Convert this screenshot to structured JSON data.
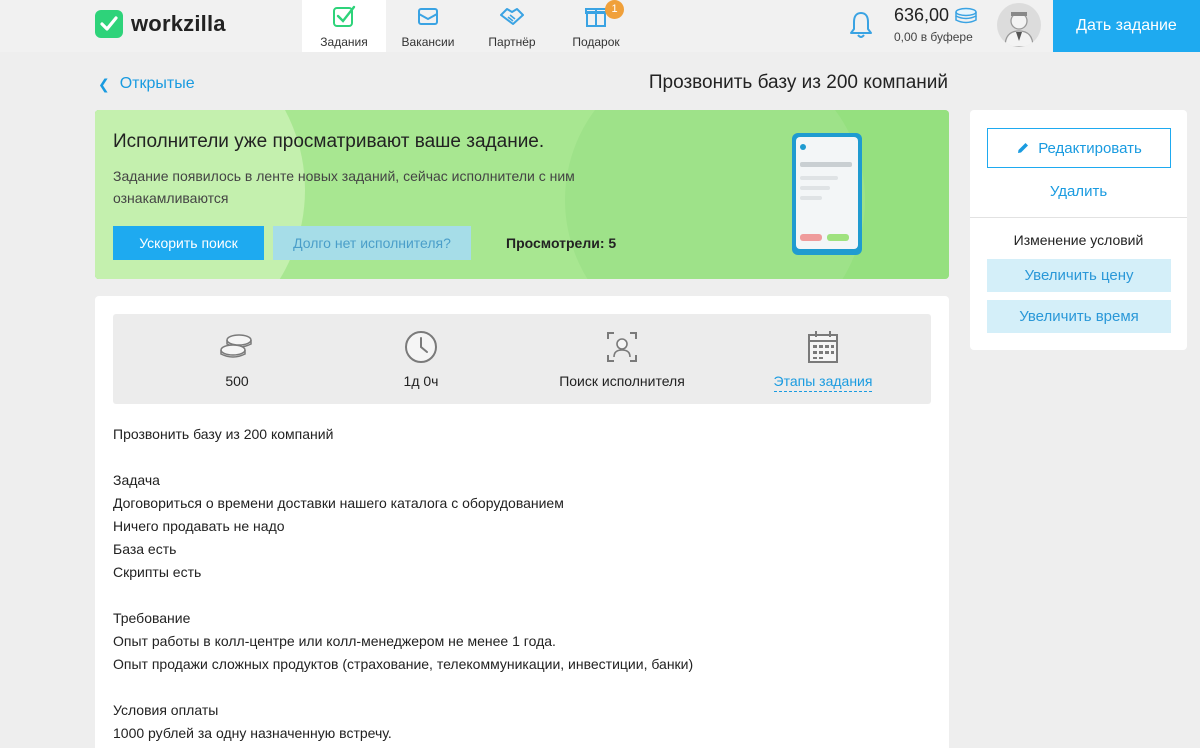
{
  "header": {
    "logo_text": "workzilla",
    "nav": [
      {
        "label": "Задания",
        "icon": "tasks-check-icon",
        "active": true
      },
      {
        "label": "Вакансии",
        "icon": "vacancies-mail-icon",
        "active": false
      },
      {
        "label": "Партнёр",
        "icon": "partner-handshake-icon",
        "active": false
      },
      {
        "label": "Подарок",
        "icon": "gift-icon",
        "active": false,
        "badge": "1"
      }
    ],
    "balance": "636,00",
    "buffer": "0,00 в буфере",
    "give_task": "Дать задание"
  },
  "back_label": "Открытые",
  "page_title": "Прозвонить базу из 200 компаний",
  "banner": {
    "title": "Исполнители уже просматривают ваше задание.",
    "text": "Задание появилось в ленте новых заданий, сейчас исполнители с ним ознакамливаются",
    "speed_button": "Ускорить поиск",
    "long_button": "Долго нет исполнителя?",
    "viewed": "Просмотрели: 5"
  },
  "side": {
    "edit": "Редактировать",
    "delete": "Удалить",
    "conditions_title": "Изменение условий",
    "increase_price": "Увеличить цену",
    "increase_time": "Увеличить время"
  },
  "stats": {
    "price": "500",
    "time": "1д 0ч",
    "status": "Поиск исполнителя",
    "stages": "Этапы задания"
  },
  "description": [
    "Прозвонить базу из 200 компаний",
    "",
    "Задача",
    "Договориться о времени доставки нашего каталога с оборудованием",
    "Ничего продавать не надо",
    "База есть",
    "Скрипты есть",
    "",
    "Требование",
    "Опыт работы в колл-центре или колл-менеджером не менее 1 года.",
    "Опыт продажи сложных продуктов (страхование, телекоммуникации, инвестиции, банки)",
    "",
    "Условия оплаты",
    "1000 рублей за одну назначенную встречу."
  ],
  "colors": {
    "accent": "#1eaaf0",
    "banner_green": "#8fe07a",
    "logo_green": "#2ed37a",
    "badge_orange": "#f0a03a"
  }
}
